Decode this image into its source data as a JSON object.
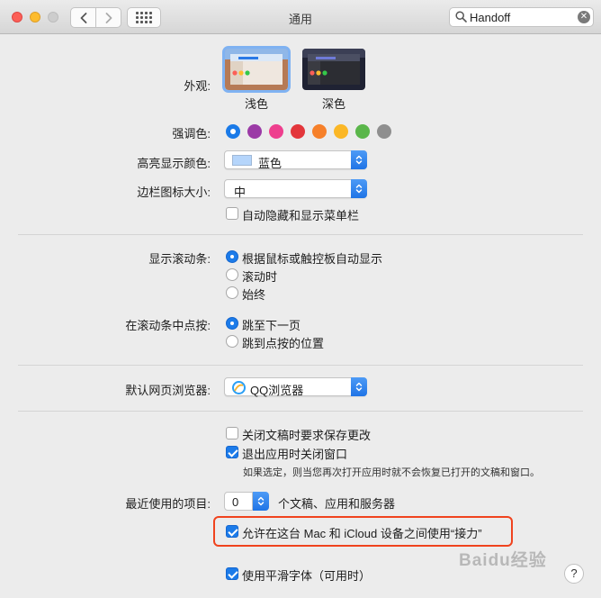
{
  "window": {
    "title": "通用"
  },
  "search": {
    "value": "Handoff",
    "clear_symbol": "✕"
  },
  "appearance": {
    "label": "外观:",
    "options": [
      {
        "label": "浅色",
        "selected": true
      },
      {
        "label": "深色",
        "selected": false
      }
    ]
  },
  "accent": {
    "label": "强调色:",
    "colors": [
      "#1a7ae8",
      "#9b3aa6",
      "#ee3f8e",
      "#e3363b",
      "#f6802a",
      "#fbb726",
      "#5ab64a",
      "#8f8f8f"
    ],
    "selected_index": 0
  },
  "highlight_color": {
    "label": "高亮显示颜色:",
    "value": "蓝色",
    "swatch": "#b5d5fb"
  },
  "sidebar_icon_size": {
    "label": "边栏图标大小:",
    "value": "中"
  },
  "auto_hide_menu": {
    "label": "自动隐藏和显示菜单栏",
    "checked": false
  },
  "show_scrollbars": {
    "label": "显示滚动条:",
    "options": [
      {
        "label": "根据鼠标或触控板自动显示",
        "selected": true
      },
      {
        "label": "滚动时",
        "selected": false
      },
      {
        "label": "始终",
        "selected": false
      }
    ]
  },
  "scrollbar_click": {
    "label": "在滚动条中点按:",
    "options": [
      {
        "label": "跳至下一页",
        "selected": true
      },
      {
        "label": "跳到点按的位置",
        "selected": false
      }
    ]
  },
  "default_browser": {
    "label": "默认网页浏览器:",
    "value": "QQ浏览器"
  },
  "ask_keep_changes": {
    "label": "关闭文稿时要求保存更改",
    "checked": false
  },
  "close_windows": {
    "label": "退出应用时关闭窗口",
    "checked": true
  },
  "close_windows_note": "如果选定，则当您再次打开应用时就不会恢复已打开的文稿和窗口。",
  "recent_items": {
    "label": "最近使用的项目:",
    "value": "0",
    "suffix": "个文稿、应用和服务器"
  },
  "handoff": {
    "label": "允许在这台 Mac 和 iCloud 设备之间使用“接力”",
    "checked": true
  },
  "font_smoothing": {
    "label": "使用平滑字体（可用时）",
    "checked": true
  },
  "watermark": "Baidu经验",
  "help_label": "?"
}
